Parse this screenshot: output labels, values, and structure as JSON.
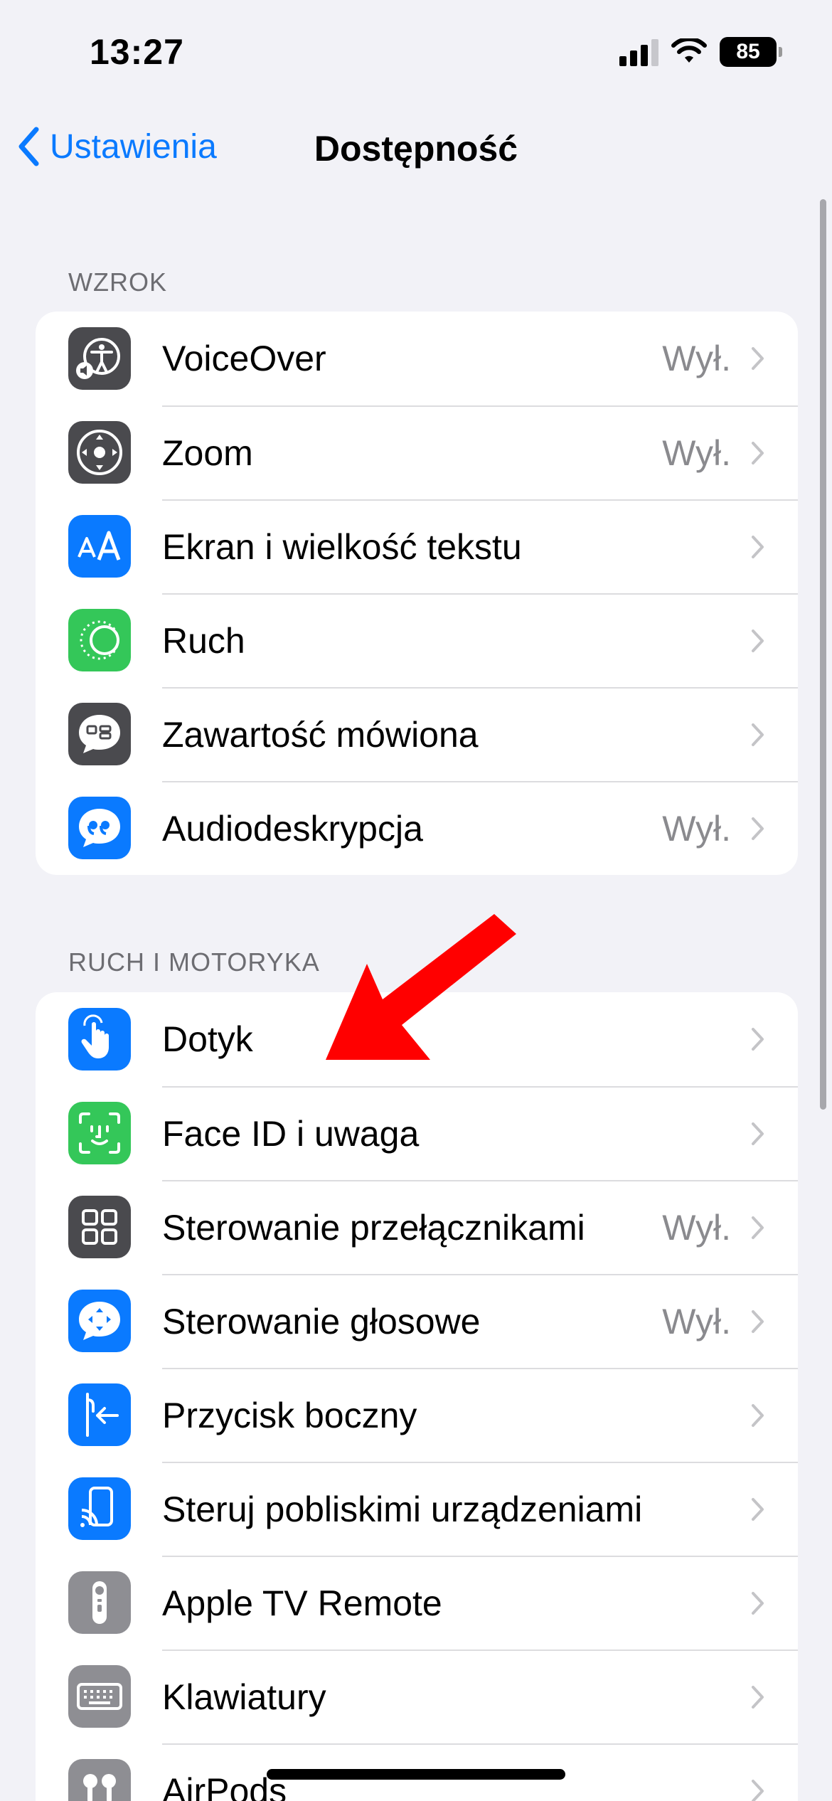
{
  "status_bar": {
    "time": "13:27",
    "battery": "85"
  },
  "nav": {
    "back_label": "Ustawienia",
    "title": "Dostępność"
  },
  "sections": [
    {
      "header": "WZROK",
      "items": [
        {
          "label": "VoiceOver",
          "value": "Wył.",
          "icon": "voiceover-icon",
          "color": "#4a4a4e"
        },
        {
          "label": "Zoom",
          "value": "Wył.",
          "icon": "zoom-icon",
          "color": "#4a4a4e"
        },
        {
          "label": "Ekran i wielkość tekstu",
          "value": "",
          "icon": "text-size-icon",
          "color": "#0a7aff"
        },
        {
          "label": "Ruch",
          "value": "",
          "icon": "motion-icon",
          "color": "#34c759"
        },
        {
          "label": "Zawartość mówiona",
          "value": "",
          "icon": "spoken-content-icon",
          "color": "#4a4a4e"
        },
        {
          "label": "Audiodeskrypcja",
          "value": "Wył.",
          "icon": "audio-description-icon",
          "color": "#0a7aff"
        }
      ]
    },
    {
      "header": "RUCH I MOTORYKA",
      "items": [
        {
          "label": "Dotyk",
          "value": "",
          "icon": "touch-icon",
          "color": "#0a7aff"
        },
        {
          "label": "Face ID i uwaga",
          "value": "",
          "icon": "face-id-icon",
          "color": "#34c759"
        },
        {
          "label": "Sterowanie przełącznikami",
          "value": "Wył.",
          "icon": "switch-control-icon",
          "color": "#4a4a4e"
        },
        {
          "label": "Sterowanie głosowe",
          "value": "Wył.",
          "icon": "voice-control-icon",
          "color": "#0a7aff"
        },
        {
          "label": "Przycisk boczny",
          "value": "",
          "icon": "side-button-icon",
          "color": "#0a7aff"
        },
        {
          "label": "Steruj pobliskimi urządzeniami",
          "value": "",
          "icon": "nearby-devices-icon",
          "color": "#0a7aff"
        },
        {
          "label": "Apple TV Remote",
          "value": "",
          "icon": "tv-remote-icon",
          "color": "#8e8e93"
        },
        {
          "label": "Klawiatury",
          "value": "",
          "icon": "keyboard-icon",
          "color": "#8e8e93"
        },
        {
          "label": "AirPods",
          "value": "",
          "icon": "airpods-icon",
          "color": "#8e8e93"
        }
      ]
    }
  ],
  "colors": {
    "accent": "#0a7aff",
    "annotation_arrow": "#ff0000"
  }
}
